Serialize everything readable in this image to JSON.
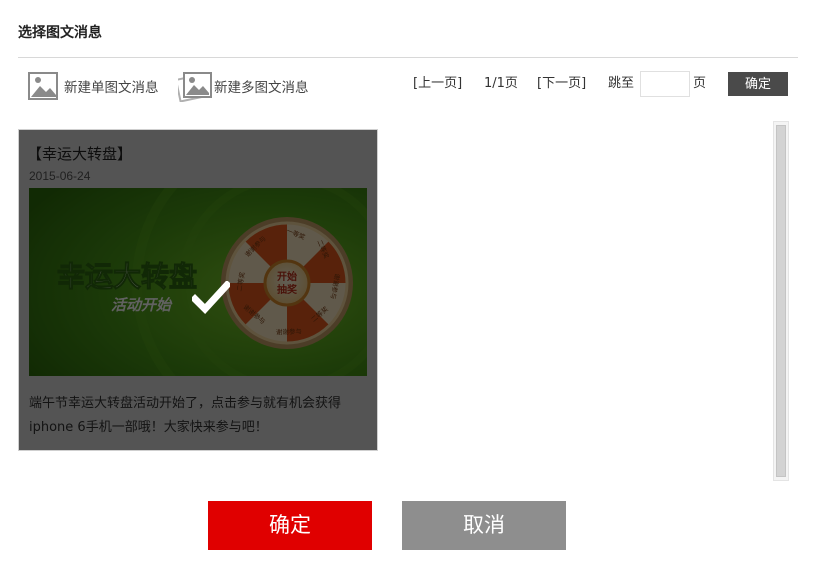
{
  "dialog": {
    "title": "选择图文消息"
  },
  "toolbar": {
    "new_single_label": "新建单图文消息",
    "new_multi_label": "新建多图文消息"
  },
  "pager": {
    "prev_label": "[上一页]",
    "page_info": "1/1页",
    "next_label": "[下一页]",
    "jump_label": "跳至",
    "jump_input_value": "",
    "page_suffix": "页",
    "confirm_label": "确定"
  },
  "card": {
    "title": "【幸运大转盘】",
    "date": "2015-06-24",
    "description": "端午节幸运大转盘活动开始了，点击参与就有机会获得iphone 6手机一部哦！大家快来参与吧！",
    "selected": true,
    "cover": {
      "headline": "幸运大转盘",
      "subline": "活动开始",
      "wheel_center": [
        "开始",
        "抽奖"
      ],
      "wheel_prizes": [
        "一等奖",
        "二等奖",
        "谢谢参与",
        "二等奖",
        "谢谢参与",
        "谢谢参与",
        "二等奖",
        "谢谢参与"
      ]
    }
  },
  "footer": {
    "confirm_label": "确定",
    "cancel_label": "取消"
  },
  "colors": {
    "confirm_red": "#e00000",
    "cancel_gray": "#8e8e8e",
    "overlay_dark": "#000000",
    "cover_green": "#3f8a12",
    "wheel_orange": "#e8561c"
  },
  "icons": [
    "image-icon",
    "multi-image-icon",
    "checkmark-icon"
  ]
}
